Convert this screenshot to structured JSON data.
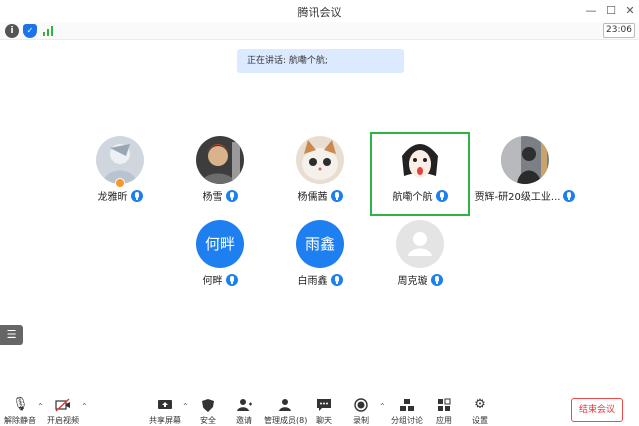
{
  "window": {
    "title": "腾讯会议"
  },
  "status": {
    "time": "23:06"
  },
  "banner": {
    "speaking_text": "正在讲话: 航嘞个航;"
  },
  "participants": [
    {
      "name": "龙雅昕"
    },
    {
      "name": "杨雪"
    },
    {
      "name": "杨儒茜"
    },
    {
      "name": "航嘞个航"
    },
    {
      "name": "贾辉-研20级工业..."
    },
    {
      "name": "何畔",
      "initials": "何畔"
    },
    {
      "name": "白雨鑫",
      "initials": "雨鑫"
    },
    {
      "name": "周克璇"
    }
  ],
  "toolbar": {
    "unmute": "解除静音",
    "start_video": "开启视频",
    "share_screen": "共享屏幕",
    "security": "安全",
    "invite": "邀请",
    "manage_members": "管理成员(8)",
    "chat": "聊天",
    "record": "录制",
    "breakout": "分组讨论",
    "apps": "应用",
    "settings": "设置",
    "end_meeting": "结束会议"
  },
  "colors": {
    "accent": "#1e7ff0",
    "active_border": "#2fb344",
    "end_red": "#f24848",
    "banner_bg": "#dceaff"
  }
}
